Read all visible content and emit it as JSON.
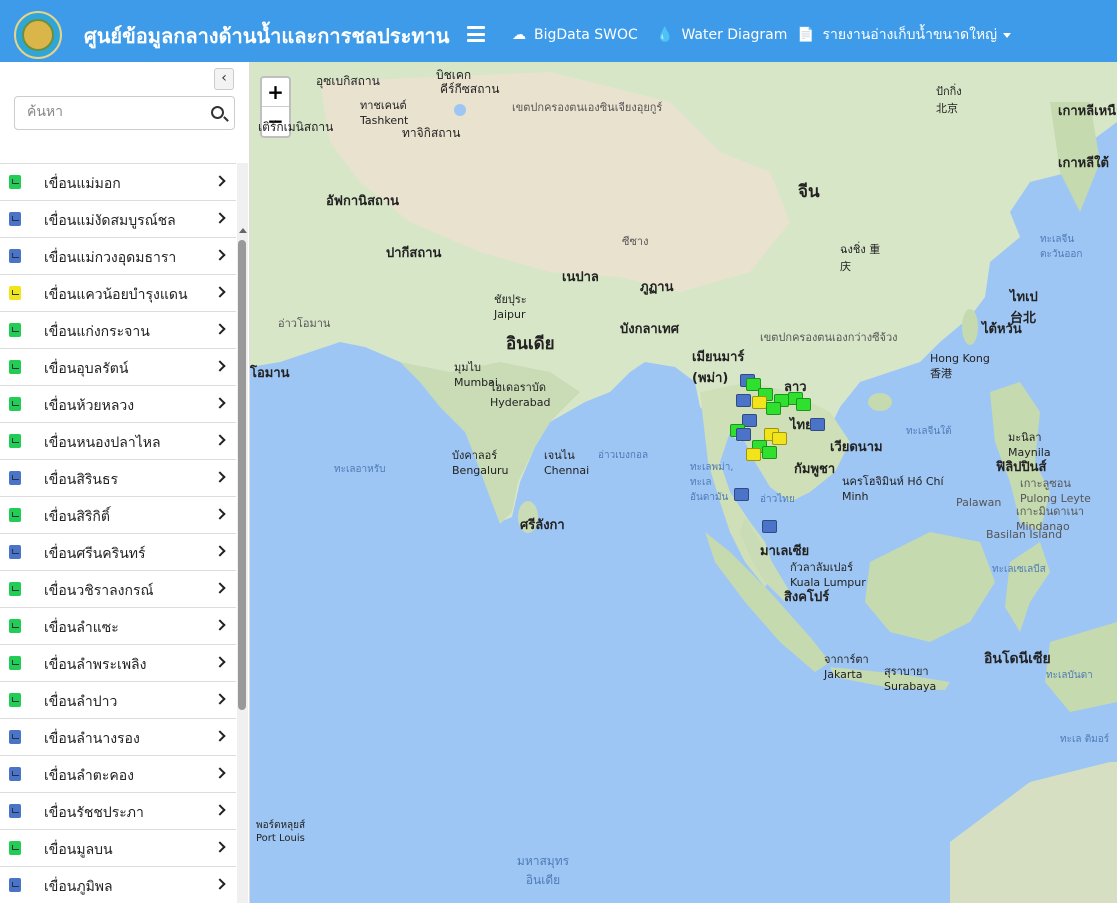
{
  "header": {
    "title": "ศูนย์ข้อมูลกลางด้านน้ำและการชลประทาน",
    "nav": [
      {
        "label": "BigData SWOC",
        "icon": "cloud-icon"
      },
      {
        "label": "Water Diagram",
        "icon": "water-drop-icon"
      },
      {
        "label": "รายงานอ่างเก็บน้ำขนาดใหญ่",
        "icon": "document-icon"
      }
    ],
    "colors": {
      "bar": "#3d9be9"
    }
  },
  "sidebar": {
    "search_placeholder": "ค้นหา",
    "items": [
      {
        "label": "เขื่อนแม่มอก",
        "status": "green"
      },
      {
        "label": "เขื่อนแม่งัดสมบูรณ์ชล",
        "status": "blue"
      },
      {
        "label": "เขื่อนแม่กวงอุดมธารา",
        "status": "blue"
      },
      {
        "label": "เขื่อนแควน้อยบำรุงแดน",
        "status": "yellow"
      },
      {
        "label": "เขื่อนแก่งกระจาน",
        "status": "green"
      },
      {
        "label": "เขื่อนอุบลรัตน์",
        "status": "green"
      },
      {
        "label": "เขื่อนห้วยหลวง",
        "status": "green"
      },
      {
        "label": "เขื่อนหนองปลาไหล",
        "status": "green"
      },
      {
        "label": "เขื่อนสิรินธร",
        "status": "blue"
      },
      {
        "label": "เขื่อนสิริกิติ์",
        "status": "green"
      },
      {
        "label": "เขื่อนศรีนครินทร์",
        "status": "blue"
      },
      {
        "label": "เขื่อนวชิราลงกรณ์",
        "status": "green"
      },
      {
        "label": "เขื่อนลำแซะ",
        "status": "green"
      },
      {
        "label": "เขื่อนลำพระเพลิง",
        "status": "green"
      },
      {
        "label": "เขื่อนลำปาว",
        "status": "green"
      },
      {
        "label": "เขื่อนลำนางรอง",
        "status": "blue"
      },
      {
        "label": "เขื่อนลำตะคอง",
        "status": "blue"
      },
      {
        "label": "เขื่อนรัชชประภา",
        "status": "blue"
      },
      {
        "label": "เขื่อนมูลบน",
        "status": "green"
      },
      {
        "label": "เขื่อนภูมิพล",
        "status": "blue"
      }
    ]
  },
  "map": {
    "zoom_in": "+",
    "zoom_out": "−",
    "labels": {
      "china": "จีน",
      "india": "อินเดีย",
      "afghanistan": "อัฟกานิสถาน",
      "pakistan": "ปากีสถาน",
      "nepal": "เนปาล",
      "bhutan": "ภูฏาน",
      "bangladesh": "บังกลาเทศ",
      "myanmar": "เมียนมาร์ (พม่า)",
      "laos": "ลาว",
      "thailand": "ไทย",
      "vietnam": "เวียดนาม",
      "cambodia": "กัมพูชา",
      "malaysia": "มาเลเซีย",
      "srilanka": "ศรีลังกา",
      "philippines": "ฟิลิปปินส์",
      "indonesia": "อินโดนีเซีย",
      "southkorea": "เกาหลีใต้",
      "northkorea": "เกาหลีเหนือ",
      "uzbekistan": "อุซเบกิสถาน",
      "kyrgyzstan": "คีร์กีซสถาน",
      "tajikistan": "ทาจิกิสถาน",
      "turkmenistan": "เติร์กเมนิสถาน",
      "taiwan": "ไต้หวัน",
      "oman": "โอมาน",
      "tashkent": "ทาชเคนต์ Tashkent",
      "bishkek": "บิชเคก",
      "mumbai": "มุมไบ Mumbai",
      "hyderabad": "ไฮเดอราบัด Hyderabad",
      "bengaluru": "บังคาลอร์ Bengaluru",
      "chennai": "เจนไน Chennai",
      "jaipur": "ชัยปุระ Jaipur",
      "hongkong": "Hong Kong 香港",
      "hochiminh": "นครโฮจิมินห์ Hồ Chí Minh",
      "kualalumpur": "กัวลาลัมเปอร์ Kuala Lumpur",
      "singapore": "สิงคโปร์",
      "jakarta": "จาการ์ตา Jakarta",
      "surabaya": "สุราบายา Surabaya",
      "manila": "มะนิลา Maynila",
      "taipei": "ไทเป 台北",
      "beijing": "ปักกิ่ง 北京",
      "chongqing": "ฉงชิ่ง 重庆",
      "portlouis": "พอร์ตหลุยส์ Port Louis",
      "indianocean": "มหาสมุทร อินเดีย",
      "arabiansea": "ทะเลอาหรับ",
      "bayofbengal": "อ่าวเบงกอล",
      "southchinasea": "ทะเลจีนใต้",
      "andaman": "ทะเลพม่า, ทะเล อันดามัน",
      "gulfofthailand": "อ่าวไทย",
      "palawan": "Palawan",
      "mindanao": "เกาะมินดาเนา Mindanao",
      "basilan": "Basilan Island",
      "celebes": "ทะเลเซเลบีส",
      "bandasea": "ทะเลบันดา",
      "eastchinasea": "ทะเลจีน ตะวันออก",
      "luzon": "เกาะลูซอน Pulong Leyte",
      "xizang": "เขตปกครองตนเองซินเจียงอุยกูร์",
      "tibet": "ซีซาง",
      "guangxi": "เขตปกครองตนเองกว่างซีจ้วง",
      "timor": "ทะเล ติมอร์",
      "persiangulf": "อ่าวโอมาน"
    }
  }
}
